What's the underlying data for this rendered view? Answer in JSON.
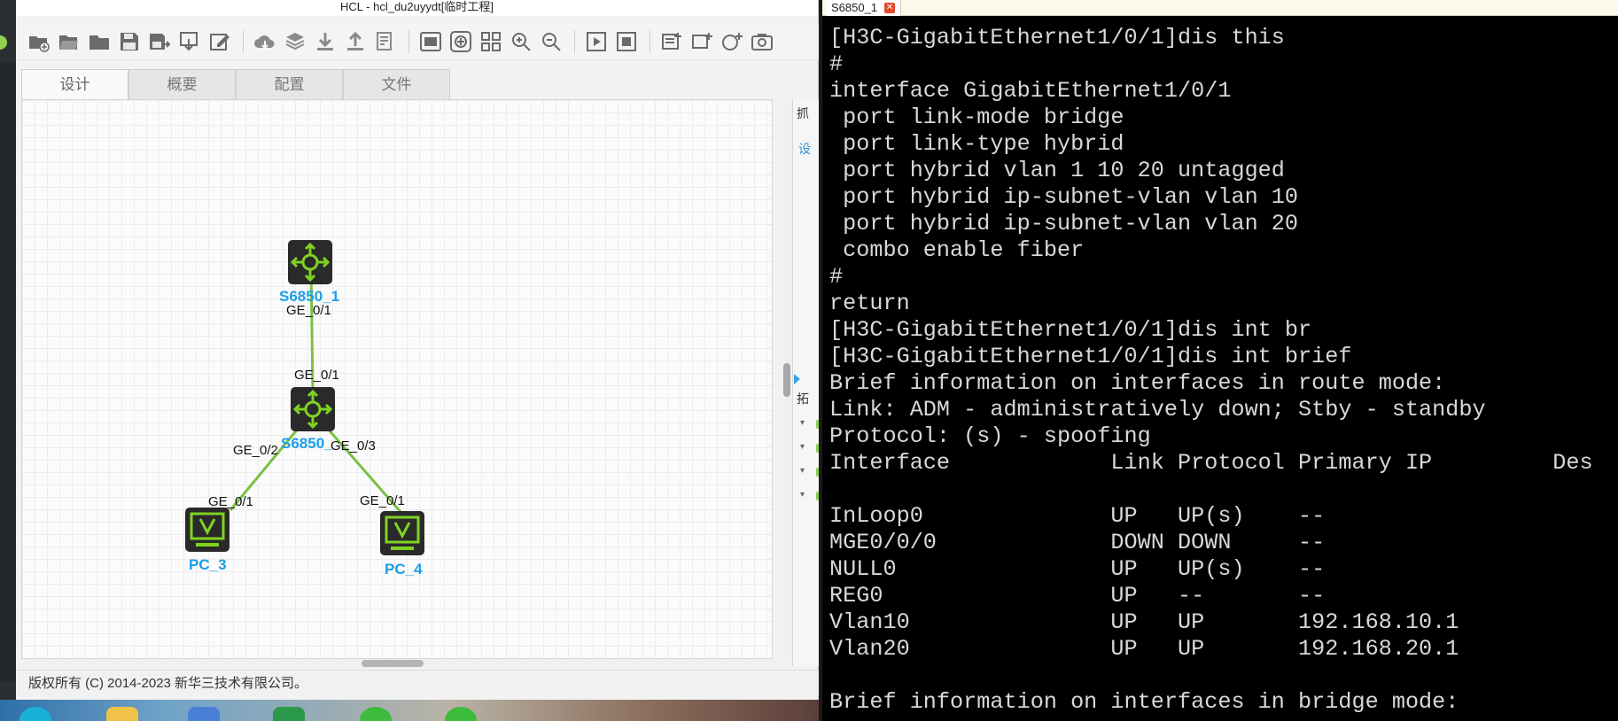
{
  "hcl": {
    "title": "HCL - hcl_du2uyydt[临时工程]",
    "tabs": [
      "设计",
      "概要",
      "配置",
      "文件"
    ],
    "active_tab": "设计",
    "side_panel": {
      "top_label": "抓",
      "link": "设",
      "bottom_label": "拓"
    },
    "status": "版权所有 (C) 2014-2023 新华三技术有限公司。",
    "toolbar_icons": [
      "new-project-icon",
      "open-project-icon",
      "open-folder-icon",
      "save-icon",
      "save-as-icon",
      "export-icon",
      "edit-icon",
      "cloud-icon",
      "layers-icon",
      "download-icon",
      "upload-icon",
      "log-icon",
      "screen-capture-icon",
      "reset-view-icon",
      "grid-icon",
      "zoom-in-icon",
      "zoom-out-icon",
      "start-all-icon",
      "stop-all-icon",
      "add-note-icon",
      "add-rectangle-icon",
      "add-ellipse-icon",
      "camera-icon"
    ],
    "topology": {
      "devices": [
        {
          "name": "S6850_1",
          "kind": "switch"
        },
        {
          "name": "S6850_",
          "kind": "switch"
        },
        {
          "name": "PC_3",
          "kind": "pc"
        },
        {
          "name": "PC_4",
          "kind": "pc"
        }
      ],
      "ports": {
        "s1_ge01": "GE_0/1",
        "s2_ge01": "GE_0/1",
        "s2_ge02": "GE_0/2",
        "s2_ge03": "GE_0/3",
        "pc3_ge01": "GE_0/1",
        "pc4_ge01": "GE_0/1"
      }
    }
  },
  "terminal": {
    "tab_title": "S6850_1",
    "lines": [
      "[H3C-GigabitEthernet1/0/1]dis this",
      "#",
      "interface GigabitEthernet1/0/1",
      " port link-mode bridge",
      " port link-type hybrid",
      " port hybrid vlan 1 10 20 untagged",
      " port hybrid ip-subnet-vlan vlan 10",
      " port hybrid ip-subnet-vlan vlan 20",
      " combo enable fiber",
      "#",
      "return",
      "[H3C-GigabitEthernet1/0/1]dis int br",
      "[H3C-GigabitEthernet1/0/1]dis int brief",
      "Brief information on interfaces in route mode:",
      "Link: ADM - administratively down; Stby - standby",
      "Protocol: (s) - spoofing",
      "Interface            Link Protocol Primary IP         Des",
      "",
      "InLoop0              UP   UP(s)    --",
      "MGE0/0/0             DOWN DOWN     --",
      "NULL0                UP   UP(s)    --",
      "REG0                 UP   --       --",
      "Vlan10               UP   UP       192.168.10.1",
      "Vlan20               UP   UP       192.168.20.1",
      "",
      "Brief information on interfaces in bridge mode:"
    ]
  },
  "colors": {
    "link_green": "#7bc043",
    "device_label_blue": "#1a9ee8",
    "terminal_bg": "#000000",
    "terminal_text": "#d8d8d8"
  }
}
